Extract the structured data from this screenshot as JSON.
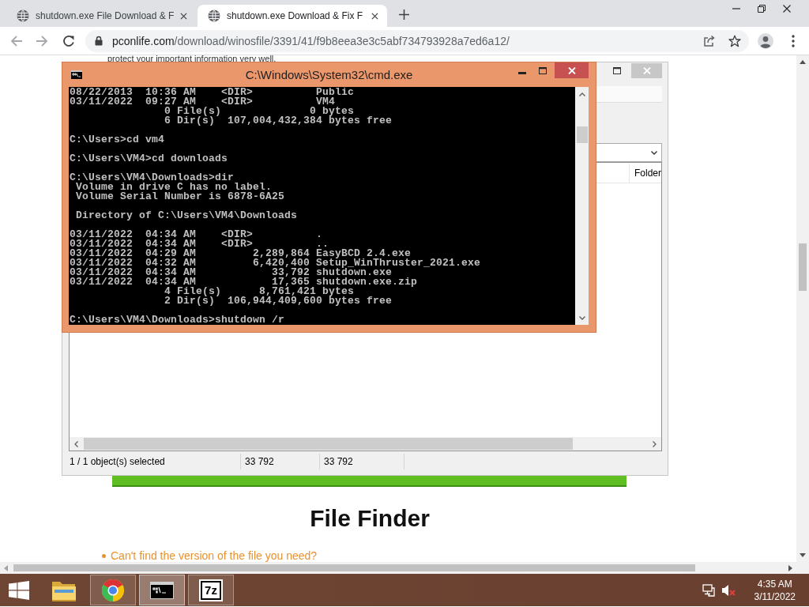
{
  "browser": {
    "tabs": [
      {
        "title": "shutdown.exe File Download & F",
        "selected": false
      },
      {
        "title": "shutdown.exe Download & Fix F",
        "selected": true
      }
    ],
    "address": {
      "host": "pconlife.com",
      "path": "/download/winosfile/3391/41/f9b8eea3e3c5abf734793928a7ed6a12/"
    }
  },
  "page": {
    "intro": "protect your important information very well.",
    "heading": "File Finder",
    "links": [
      "Can't find the version of the file you need?"
    ]
  },
  "archive_window": {
    "columns": [
      "Folder"
    ],
    "status_bar": [
      "1 / 1 object(s) selected",
      "33 792",
      "33 792"
    ]
  },
  "console_window": {
    "title": "C:\\Windows\\System32\\cmd.exe",
    "blocks": [
      [
        "08/22/2013  10:36 AM    <DIR>          Public",
        "03/11/2022  09:27 AM    <DIR>          VM4",
        "               0 File(s)              0 bytes",
        "               6 Dir(s)  107,004,432,384 bytes free"
      ],
      [
        "C:\\Users>cd vm4"
      ],
      [
        "C:\\Users\\VM4>cd downloads"
      ],
      [
        "C:\\Users\\VM4\\Downloads>dir",
        " Volume in drive C has no label.",
        " Volume Serial Number is 6878-6A25"
      ],
      [
        " Directory of C:\\Users\\VM4\\Downloads"
      ],
      [
        "03/11/2022  04:34 AM    <DIR>          .",
        "03/11/2022  04:34 AM    <DIR>          ..",
        "03/11/2022  04:29 AM         2,289,864 EasyBCD 2.4.exe",
        "03/11/2022  04:32 AM         6,420,400 Setup_WinThruster_2021.exe",
        "03/11/2022  04:34 AM            33,792 shutdown.exe",
        "03/11/2022  04:34 AM            17,365 shutdown.exe.zip",
        "               4 File(s)      8,761,421 bytes",
        "               2 Dir(s)  106,944,409,600 bytes free"
      ],
      [
        "C:\\Users\\VM4\\Downloads>shutdown /r"
      ]
    ]
  },
  "taskbar": {
    "apps": [
      {
        "kind": "explorer",
        "open": false,
        "selected": false
      },
      {
        "kind": "browser",
        "open": true,
        "selected": false
      },
      {
        "kind": "console",
        "open": true,
        "selected": true
      },
      {
        "kind": "archiver",
        "open": true,
        "selected": false,
        "logo_text": "7z"
      }
    ],
    "volume": {
      "muted": true
    },
    "clock": {
      "time": "4:35 AM",
      "date": "3/11/2022"
    }
  }
}
